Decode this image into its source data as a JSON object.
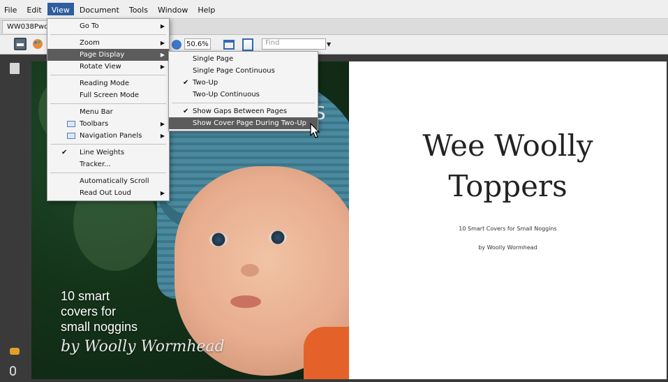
{
  "menubar": {
    "items": [
      "File",
      "Edit",
      "View",
      "Document",
      "Tools",
      "Window",
      "Help"
    ],
    "active": "View"
  },
  "tab": {
    "label": "WW038Pwo"
  },
  "toolbar": {
    "zoom_value": "50.6%",
    "find_placeholder": "Find"
  },
  "view_menu": {
    "items": [
      {
        "label": "Go To",
        "submenu": true
      },
      {
        "separator": true
      },
      {
        "label": "Zoom",
        "submenu": true
      },
      {
        "label": "Page Display",
        "submenu": true,
        "highlight": true
      },
      {
        "label": "Rotate View",
        "submenu": true
      },
      {
        "separator": true
      },
      {
        "label": "Reading Mode"
      },
      {
        "label": "Full Screen Mode"
      },
      {
        "separator": true
      },
      {
        "label": "Menu Bar"
      },
      {
        "label": "Toolbars",
        "submenu": true,
        "icon": "toolbars-icon"
      },
      {
        "label": "Navigation Panels",
        "submenu": true,
        "icon": "navigation-panels-icon"
      },
      {
        "separator": true
      },
      {
        "label": "Line Weights",
        "checked": true
      },
      {
        "label": "Tracker..."
      },
      {
        "separator": true
      },
      {
        "label": "Automatically Scroll"
      },
      {
        "label": "Read Out Loud",
        "submenu": true
      }
    ]
  },
  "page_display_submenu": {
    "items": [
      {
        "label": "Single Page"
      },
      {
        "label": "Single Page Continuous"
      },
      {
        "label": "Two-Up",
        "checked": true
      },
      {
        "label": "Two-Up Continuous"
      },
      {
        "separator": true
      },
      {
        "label": "Show Gaps Between Pages",
        "checked": true
      },
      {
        "label": "Show Cover Page During Two-Up",
        "highlight": true
      }
    ]
  },
  "cover": {
    "lines": [
      "10 smart",
      "covers for",
      "small noggins"
    ],
    "author": "by Woolly Wormhead",
    "title_partial": "S"
  },
  "title_page": {
    "title_line1": "Wee Woolly",
    "title_line2": "Toppers",
    "subtitle": "10 Smart Covers for Small Noggins",
    "author": "by Woolly Wormhead"
  },
  "colors": {
    "menu_highlight": "#5c5c5c",
    "menubar_active": "#2f5d9e"
  }
}
